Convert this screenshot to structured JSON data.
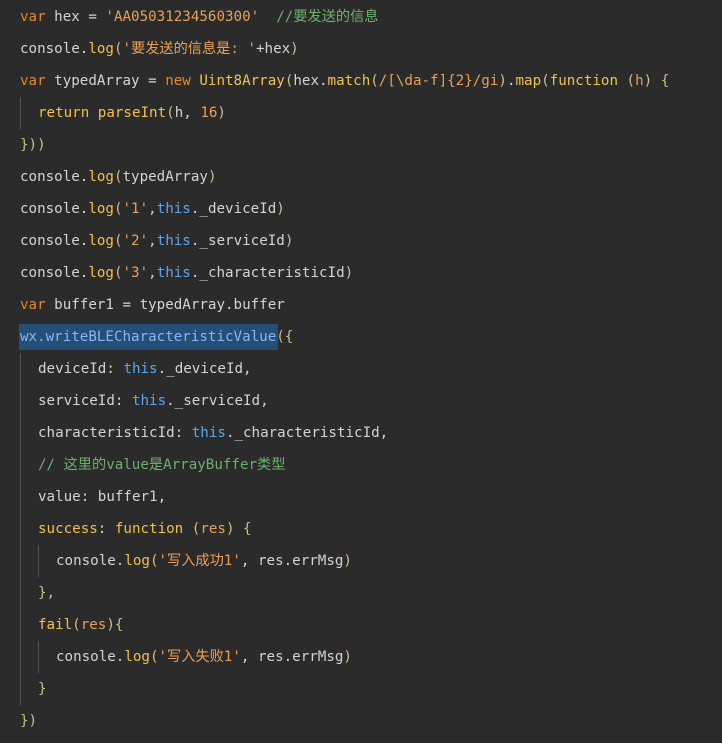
{
  "theme": {
    "background": "#2b2b2b",
    "keyword": "#f0c14b",
    "storage": "#e48a1f",
    "string": "#e8a157",
    "number": "#e8a157",
    "function": "#f2c04f",
    "property": "#89b4fa",
    "this": "#5ea6f2",
    "comment": "#6fb06f",
    "punctuation": "#cbbf8f",
    "default": "#d4d4d4",
    "selection": "#264f78"
  },
  "editor": {
    "lines": [
      {
        "indent": 0,
        "tokens": [
          {
            "t": "var",
            "c": "storage"
          },
          {
            "t": " hex = ",
            "c": "default"
          },
          {
            "t": "'AA05031234560300'",
            "c": "string"
          },
          {
            "t": "  //要发送的信息",
            "c": "comment"
          }
        ]
      },
      {
        "indent": 0,
        "tokens": [
          {
            "t": "console.",
            "c": "default"
          },
          {
            "t": "log",
            "c": "function"
          },
          {
            "t": "(",
            "c": "punctuation"
          },
          {
            "t": "'要发送的信息是: '",
            "c": "string"
          },
          {
            "t": "+hex",
            "c": "default"
          },
          {
            "t": ")",
            "c": "punctuation"
          }
        ]
      },
      {
        "indent": 0,
        "tokens": [
          {
            "t": "var",
            "c": "storage"
          },
          {
            "t": " typedArray = ",
            "c": "default"
          },
          {
            "t": "new",
            "c": "storage"
          },
          {
            "t": " ",
            "c": "default"
          },
          {
            "t": "Uint8Array",
            "c": "function"
          },
          {
            "t": "(",
            "c": "punctuation"
          },
          {
            "t": "hex.",
            "c": "default"
          },
          {
            "t": "match",
            "c": "function"
          },
          {
            "t": "(",
            "c": "punctuation"
          },
          {
            "t": "/[\\da-f]{2}/gi",
            "c": "string"
          },
          {
            "t": ")",
            "c": "punctuation"
          },
          {
            "t": ".",
            "c": "default"
          },
          {
            "t": "map",
            "c": "function"
          },
          {
            "t": "(",
            "c": "punctuation"
          },
          {
            "t": "function",
            "c": "keyword"
          },
          {
            "t": " (",
            "c": "punctuation"
          },
          {
            "t": "h",
            "c": "string"
          },
          {
            "t": ") {",
            "c": "punctuation"
          }
        ]
      },
      {
        "indent": 1,
        "tokens": [
          {
            "t": "return",
            "c": "keyword"
          },
          {
            "t": " ",
            "c": "default"
          },
          {
            "t": "parseInt",
            "c": "function"
          },
          {
            "t": "(",
            "c": "punctuation"
          },
          {
            "t": "h, ",
            "c": "default"
          },
          {
            "t": "16",
            "c": "number"
          },
          {
            "t": ")",
            "c": "punctuation"
          }
        ]
      },
      {
        "indent": 0,
        "tokens": [
          {
            "t": "}))",
            "c": "punctuation"
          }
        ]
      },
      {
        "indent": 0,
        "tokens": [
          {
            "t": "console.",
            "c": "default"
          },
          {
            "t": "log",
            "c": "function"
          },
          {
            "t": "(",
            "c": "punctuation"
          },
          {
            "t": "typedArray",
            "c": "default"
          },
          {
            "t": ")",
            "c": "punctuation"
          }
        ]
      },
      {
        "indent": 0,
        "tokens": [
          {
            "t": "console.",
            "c": "default"
          },
          {
            "t": "log",
            "c": "function"
          },
          {
            "t": "(",
            "c": "punctuation"
          },
          {
            "t": "'1'",
            "c": "string"
          },
          {
            "t": ",",
            "c": "default"
          },
          {
            "t": "this",
            "c": "this"
          },
          {
            "t": "._deviceId",
            "c": "default"
          },
          {
            "t": ")",
            "c": "punctuation"
          }
        ]
      },
      {
        "indent": 0,
        "tokens": [
          {
            "t": "console.",
            "c": "default"
          },
          {
            "t": "log",
            "c": "function"
          },
          {
            "t": "(",
            "c": "punctuation"
          },
          {
            "t": "'2'",
            "c": "string"
          },
          {
            "t": ",",
            "c": "default"
          },
          {
            "t": "this",
            "c": "this"
          },
          {
            "t": "._serviceId",
            "c": "default"
          },
          {
            "t": ")",
            "c": "punctuation"
          }
        ]
      },
      {
        "indent": 0,
        "tokens": [
          {
            "t": "console.",
            "c": "default"
          },
          {
            "t": "log",
            "c": "function"
          },
          {
            "t": "(",
            "c": "punctuation"
          },
          {
            "t": "'3'",
            "c": "string"
          },
          {
            "t": ",",
            "c": "default"
          },
          {
            "t": "this",
            "c": "this"
          },
          {
            "t": "._characteristicId",
            "c": "default"
          },
          {
            "t": ")",
            "c": "punctuation"
          }
        ]
      },
      {
        "indent": 0,
        "tokens": [
          {
            "t": "var",
            "c": "storage"
          },
          {
            "t": " buffer1 = typedArray.buffer",
            "c": "default"
          }
        ]
      },
      {
        "indent": 0,
        "selection": "wx.writeBLECharacteristicValue",
        "tokens": [
          {
            "t": "wx.",
            "c": "property"
          },
          {
            "t": "writeBLECharacteristicValue",
            "c": "property"
          },
          {
            "t": "({",
            "c": "punctuation"
          }
        ]
      },
      {
        "indent": 1,
        "tokens": [
          {
            "t": "deviceId",
            "c": "default"
          },
          {
            "t": ": ",
            "c": "default"
          },
          {
            "t": "this",
            "c": "this"
          },
          {
            "t": "._deviceId,",
            "c": "default"
          }
        ]
      },
      {
        "indent": 1,
        "tokens": [
          {
            "t": "serviceId",
            "c": "default"
          },
          {
            "t": ": ",
            "c": "default"
          },
          {
            "t": "this",
            "c": "this"
          },
          {
            "t": "._serviceId,",
            "c": "default"
          }
        ]
      },
      {
        "indent": 1,
        "tokens": [
          {
            "t": "characteristicId",
            "c": "default"
          },
          {
            "t": ": ",
            "c": "default"
          },
          {
            "t": "this",
            "c": "this"
          },
          {
            "t": "._characteristicId,",
            "c": "default"
          }
        ]
      },
      {
        "indent": 1,
        "tokens": [
          {
            "t": "// 这里的value是ArrayBuffer类型",
            "c": "comment"
          }
        ]
      },
      {
        "indent": 1,
        "tokens": [
          {
            "t": "value: buffer1,",
            "c": "default"
          }
        ]
      },
      {
        "indent": 1,
        "tokens": [
          {
            "t": "success",
            "c": "function"
          },
          {
            "t": ": ",
            "c": "default"
          },
          {
            "t": "function",
            "c": "keyword"
          },
          {
            "t": " (",
            "c": "punctuation"
          },
          {
            "t": "res",
            "c": "string"
          },
          {
            "t": ") {",
            "c": "punctuation"
          }
        ]
      },
      {
        "indent": 2,
        "tokens": [
          {
            "t": "console.",
            "c": "default"
          },
          {
            "t": "log",
            "c": "function"
          },
          {
            "t": "(",
            "c": "punctuation"
          },
          {
            "t": "'写入成功1'",
            "c": "string"
          },
          {
            "t": ", res.errMsg",
            "c": "default"
          },
          {
            "t": ")",
            "c": "punctuation"
          }
        ]
      },
      {
        "indent": 1,
        "tokens": [
          {
            "t": "},",
            "c": "punctuation"
          }
        ]
      },
      {
        "indent": 1,
        "tokens": [
          {
            "t": "fail",
            "c": "function"
          },
          {
            "t": "(",
            "c": "punctuation"
          },
          {
            "t": "res",
            "c": "string"
          },
          {
            "t": "){",
            "c": "punctuation"
          }
        ]
      },
      {
        "indent": 2,
        "tokens": [
          {
            "t": "console.",
            "c": "default"
          },
          {
            "t": "log",
            "c": "function"
          },
          {
            "t": "(",
            "c": "punctuation"
          },
          {
            "t": "'写入失败1'",
            "c": "string"
          },
          {
            "t": ", res.errMsg",
            "c": "default"
          },
          {
            "t": ")",
            "c": "punctuation"
          }
        ]
      },
      {
        "indent": 1,
        "tokens": [
          {
            "t": "}",
            "c": "punctuation"
          }
        ]
      },
      {
        "indent": 0,
        "tokens": [
          {
            "t": "})",
            "c": "punctuation"
          }
        ]
      }
    ]
  }
}
